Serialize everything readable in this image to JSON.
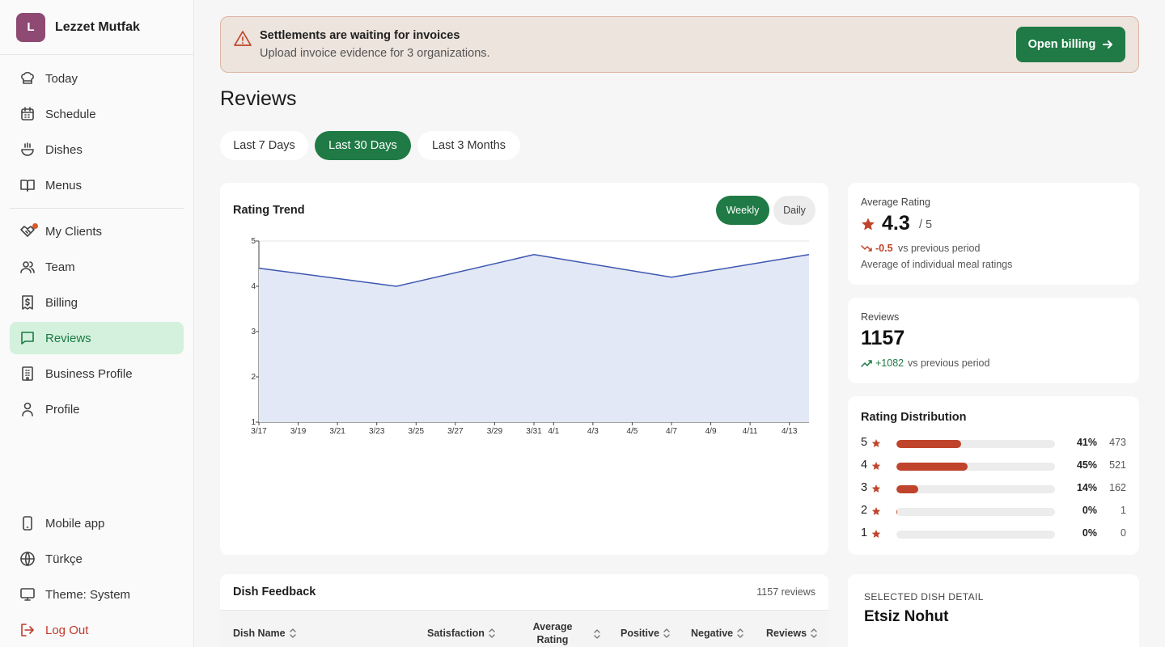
{
  "brand": {
    "initial": "L",
    "name": "Lezzet Mutfak"
  },
  "nav": {
    "today": "Today",
    "schedule": "Schedule",
    "dishes": "Dishes",
    "menus": "Menus",
    "my_clients": "My Clients",
    "team": "Team",
    "billing": "Billing",
    "reviews": "Reviews",
    "business_profile": "Business Profile",
    "profile": "Profile",
    "mobile_app": "Mobile app",
    "language": "Türkçe",
    "theme": "Theme: System",
    "logout": "Log Out",
    "active": "reviews"
  },
  "banner": {
    "title": "Settlements are waiting for invoices",
    "subtitle": "Upload invoice evidence for 3 organizations.",
    "button": "Open billing"
  },
  "page": {
    "title": "Reviews"
  },
  "periods": [
    {
      "label": "Last 7 Days",
      "active": false
    },
    {
      "label": "Last 30 Days",
      "active": true
    },
    {
      "label": "Last 3 Months",
      "active": false
    }
  ],
  "trend": {
    "title": "Rating Trend",
    "toggle_weekly": "Weekly",
    "toggle_daily": "Daily"
  },
  "chart_data": {
    "type": "area",
    "title": "Rating Trend",
    "x": [
      "3/17",
      "3/24",
      "3/31",
      "4/7",
      "4/14"
    ],
    "values": [
      4.4,
      4.0,
      4.7,
      4.2,
      4.7
    ],
    "ylim": [
      1,
      5
    ],
    "yticks": [
      1,
      2,
      3,
      4,
      5
    ],
    "xticks": [
      "3/17",
      "3/19",
      "3/21",
      "3/23",
      "3/25",
      "3/27",
      "3/29",
      "3/31",
      "4/1",
      "4/3",
      "4/5",
      "4/7",
      "4/9",
      "4/11",
      "4/13"
    ],
    "grid": true,
    "colors": {
      "line": "#3d57b0",
      "fill": "#e3e8f6"
    }
  },
  "average": {
    "label": "Average Rating",
    "value": "4.3",
    "out_of": "/ 5",
    "delta": "-0.5",
    "delta_text": "vs previous period",
    "note": "Average of individual meal ratings"
  },
  "reviews": {
    "label": "Reviews",
    "value": "1157",
    "delta": "+1082",
    "delta_text": "vs previous period"
  },
  "distribution": {
    "title": "Rating Distribution",
    "rows": [
      {
        "stars": "5",
        "pct": "41%",
        "count": "473",
        "fraction": 0.41
      },
      {
        "stars": "4",
        "pct": "45%",
        "count": "521",
        "fraction": 0.45
      },
      {
        "stars": "3",
        "pct": "14%",
        "count": "162",
        "fraction": 0.14
      },
      {
        "stars": "2",
        "pct": "0%",
        "count": "1",
        "fraction": 0.005
      },
      {
        "stars": "1",
        "pct": "0%",
        "count": "0",
        "fraction": 0
      }
    ]
  },
  "dish_feedback": {
    "title": "Dish Feedback",
    "count": "1157 reviews",
    "columns": {
      "dish_name": "Dish Name",
      "satisfaction": "Satisfaction",
      "average_rating_1": "Average",
      "average_rating_2": "Rating",
      "positive": "Positive",
      "negative": "Negative",
      "reviews": "Reviews"
    }
  },
  "detail": {
    "label": "SELECTED DISH DETAIL",
    "name": "Etsiz Nohut"
  },
  "colors": {
    "accent": "#1f7a45",
    "active_nav_bg": "#d3f1dc",
    "warning": "#c0442b",
    "brand": "#8e4a73"
  }
}
